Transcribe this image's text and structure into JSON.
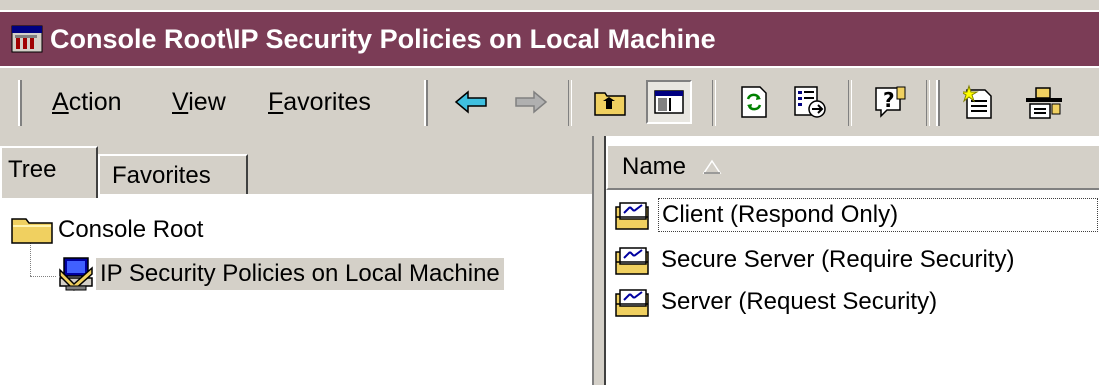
{
  "window": {
    "title": "Console Root\\IP Security Policies on Local Machine",
    "title_icon": "mmc-console-icon",
    "title_bar_color": "#7b3c56"
  },
  "menu": {
    "items": [
      {
        "label": "Action",
        "accel": "A"
      },
      {
        "label": "View",
        "accel": "V"
      },
      {
        "label": "Favorites",
        "accel": "F"
      }
    ]
  },
  "toolbar": {
    "buttons": [
      {
        "icon": "back-arrow-icon"
      },
      {
        "icon": "forward-arrow-icon"
      },
      {
        "icon": "up-one-level-icon"
      },
      {
        "icon": "show-hide-console-tree-icon",
        "pressed": true
      },
      {
        "icon": "refresh-icon"
      },
      {
        "icon": "export-list-icon"
      },
      {
        "icon": "help-icon"
      },
      {
        "icon": "create-ip-security-policy-icon"
      },
      {
        "icon": "manage-filter-lists-icon"
      }
    ]
  },
  "left_pane": {
    "tabs": [
      {
        "label": "Tree",
        "active": true
      },
      {
        "label": "Favorites",
        "active": false
      }
    ],
    "tree": [
      {
        "label": "Console Root",
        "icon": "folder-icon",
        "level": 0
      },
      {
        "label": "IP Security Policies on Local Machine",
        "icon": "ip-security-policy-icon",
        "level": 1,
        "selected": true
      }
    ]
  },
  "right_pane": {
    "columns": [
      {
        "label": "Name",
        "sort": "ascending"
      }
    ],
    "items": [
      {
        "label": "Client (Respond Only)",
        "icon": "policy-icon",
        "focused": true
      },
      {
        "label": "Secure Server (Require Security)",
        "icon": "policy-icon"
      },
      {
        "label": "Server (Request Security)",
        "icon": "policy-icon"
      }
    ]
  }
}
